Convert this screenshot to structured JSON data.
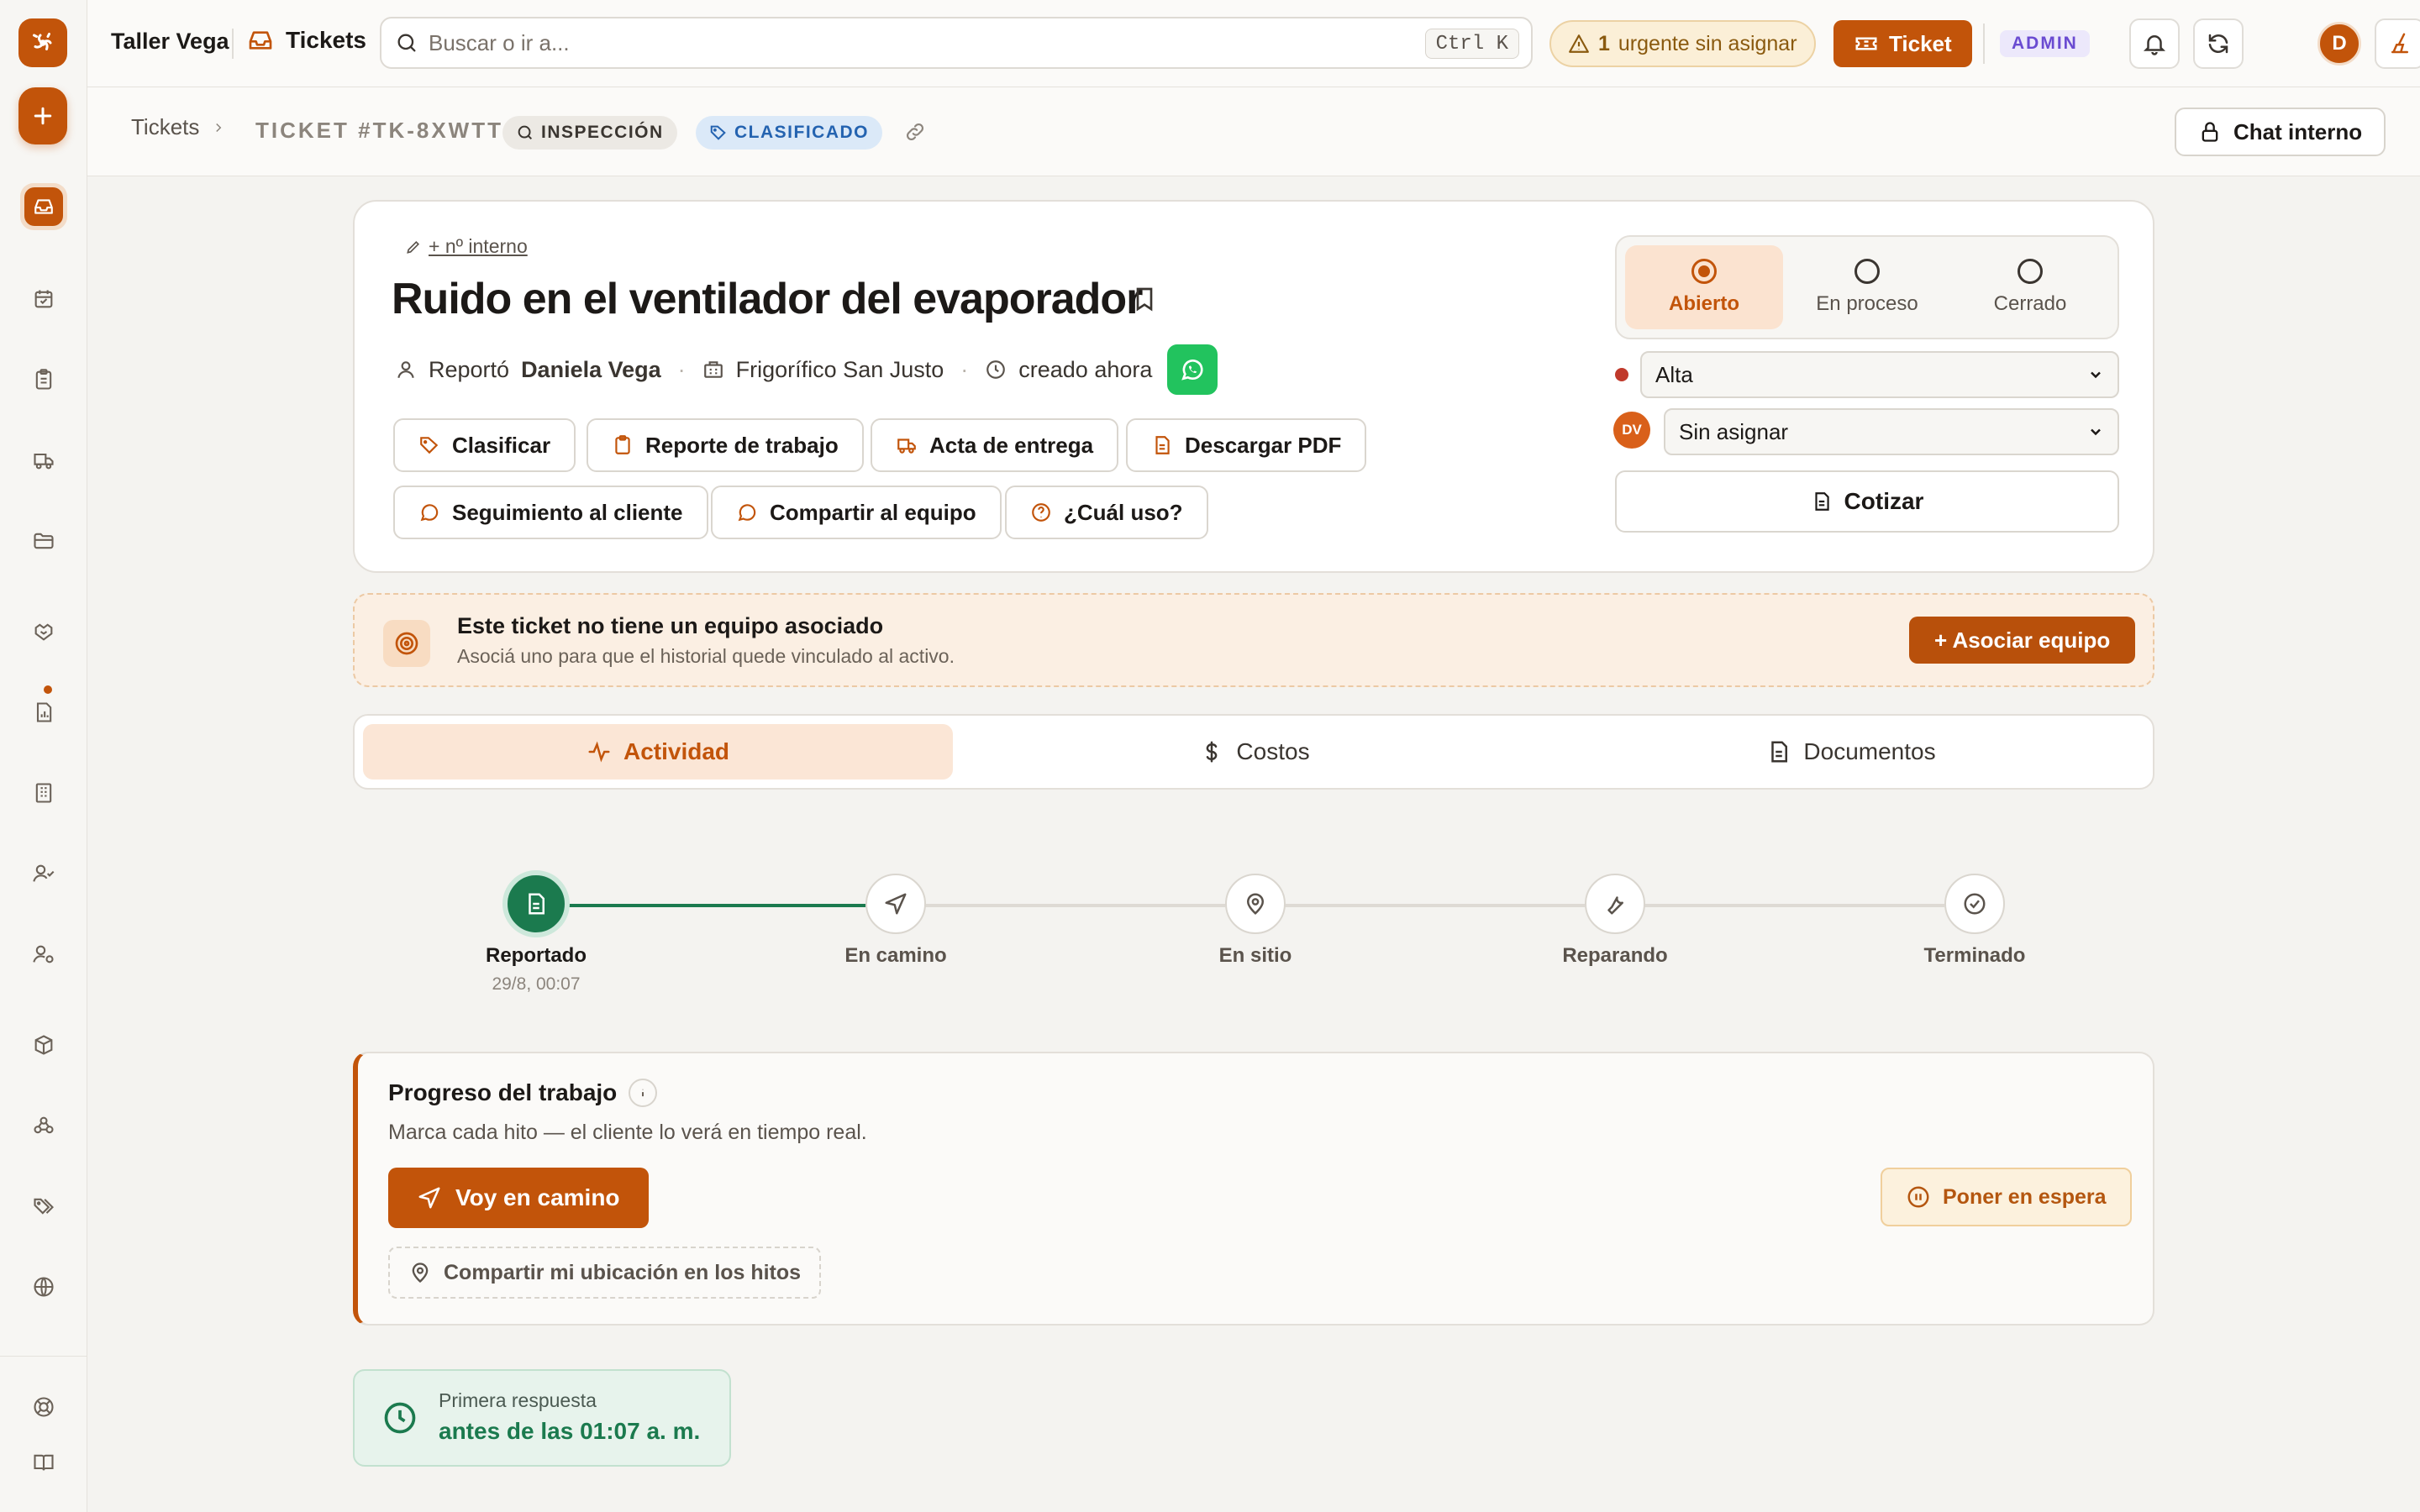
{
  "colors": {
    "accent": "#c2540a",
    "success": "#1b7a4e",
    "whatsapp": "#22c35e",
    "priority_high": "#c0392b"
  },
  "sidebar": {
    "icons": [
      "logo-icon",
      "plus-icon",
      "inbox-icon",
      "calendar-icon",
      "clipboard-icon",
      "truck-icon",
      "folder-icon",
      "handshake-icon",
      "report-icon",
      "building-icon",
      "user-check-icon",
      "user-settings-icon",
      "box-icon",
      "network-icon",
      "tags-icon",
      "globe-icon",
      "lifebuoy-icon",
      "book-icon"
    ]
  },
  "topbar": {
    "org": "Taller Vega",
    "page": "Tickets",
    "search_placeholder": "Buscar o ir a...",
    "search_shortcut": "Ctrl K",
    "urgent_count": "1",
    "urgent_text": "urgente sin asignar",
    "new_ticket": "Ticket",
    "role": "ADMIN",
    "avatar": "D"
  },
  "breadcrumb": {
    "root": "Tickets",
    "ticket_id": "TICKET #TK-8XWTT",
    "tag_stage": "INSPECCIÓN",
    "tag_class": "CLASIFICADO",
    "chat": "Chat interno"
  },
  "ticket": {
    "internal_number_link": "+ nº interno",
    "title": "Ruido en el ventilador del evaporador",
    "reported_label": "Reportó",
    "reporter": "Daniela Vega",
    "client": "Frigorífico San Justo",
    "created": "creado ahora",
    "actions": {
      "classify": "Clasificar",
      "work_report": "Reporte de trabajo",
      "delivery": "Acta de entrega",
      "pdf": "Descargar PDF",
      "follow_up": "Seguimiento al cliente",
      "share_team": "Compartir al equipo",
      "which_use": "¿Cuál uso?"
    },
    "status": {
      "open": "Abierto",
      "in_progress": "En proceso",
      "closed": "Cerrado",
      "selected": "Abierto"
    },
    "priority": "Alta",
    "assignee_initials": "DV",
    "assignee": "Sin asignar",
    "quote": "Cotizar"
  },
  "equipment_banner": {
    "title": "Este ticket no tiene un equipo asociado",
    "subtitle": "Asociá uno para que el historial quede vinculado al activo.",
    "button": "+ Asociar equipo"
  },
  "tabs": {
    "activity": "Actividad",
    "costs": "Costos",
    "documents": "Documentos",
    "selected": "Actividad"
  },
  "timeline": {
    "steps": [
      {
        "label": "Reportado",
        "time": "29/8, 00:07",
        "done": true
      },
      {
        "label": "En camino"
      },
      {
        "label": "En sitio"
      },
      {
        "label": "Reparando"
      },
      {
        "label": "Terminado"
      }
    ]
  },
  "progress": {
    "title": "Progreso del trabajo",
    "subtitle": "Marca cada hito — el cliente lo verá en tiempo real.",
    "go_button": "Voy en camino",
    "share_location": "Compartir mi ubicación en los hitos",
    "hold_button": "Poner en espera"
  },
  "first_response": {
    "label": "Primera respuesta",
    "value": "antes de las 01:07 a. m."
  }
}
